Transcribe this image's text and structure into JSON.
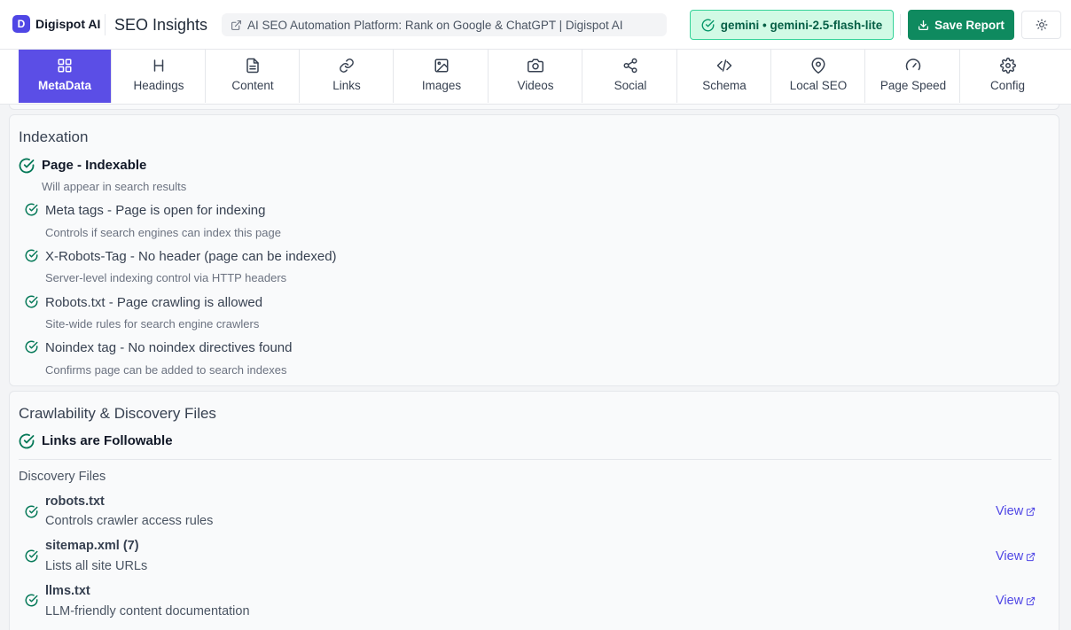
{
  "header": {
    "logo_letter": "D",
    "logo_text": "Digispot AI",
    "app_title": "SEO Insights",
    "page_url_title": "AI SEO Automation Platform: Rank on Google & ChatGPT | Digispot AI",
    "model_badge": "gemini • gemini-2.5-flash-lite",
    "save_label": "Save Report"
  },
  "tabs": [
    {
      "label": "MetaData",
      "icon": "grid-icon",
      "active": true
    },
    {
      "label": "Headings",
      "icon": "heading-icon"
    },
    {
      "label": "Content",
      "icon": "document-icon"
    },
    {
      "label": "Links",
      "icon": "link-icon"
    },
    {
      "label": "Images",
      "icon": "image-icon"
    },
    {
      "label": "Videos",
      "icon": "camera-icon"
    },
    {
      "label": "Social",
      "icon": "share-icon"
    },
    {
      "label": "Schema",
      "icon": "code-icon"
    },
    {
      "label": "Local SEO",
      "icon": "map-pin-icon"
    },
    {
      "label": "Page Speed",
      "icon": "gauge-icon"
    },
    {
      "label": "Config",
      "icon": "gear-icon"
    }
  ],
  "indexation": {
    "title": "Indexation",
    "main": {
      "label": "Page - Indexable",
      "desc": "Will appear in search results"
    },
    "items": [
      {
        "label": "Meta tags - Page is open for indexing",
        "desc": "Controls if search engines can index this page"
      },
      {
        "label": "X-Robots-Tag - No header (page can be indexed)",
        "desc": "Server-level indexing control via HTTP headers"
      },
      {
        "label": "Robots.txt - Page crawling is allowed",
        "desc": "Site-wide rules for search engine crawlers"
      },
      {
        "label": "Noindex tag - No noindex directives found",
        "desc": "Confirms page can be added to search indexes"
      }
    ]
  },
  "crawlability": {
    "title": "Crawlability & Discovery Files",
    "main": {
      "label": "Links are Followable"
    },
    "discovery_title": "Discovery Files",
    "files": [
      {
        "name": "robots.txt",
        "desc": "Controls crawler access rules",
        "action": "View"
      },
      {
        "name": "sitemap.xml (7)",
        "desc": "Lists all site URLs",
        "action": "View"
      },
      {
        "name": "llms.txt",
        "desc": "LLM-friendly content documentation",
        "action": "View"
      }
    ]
  },
  "colors": {
    "accent": "#5b4ee6",
    "success": "#0f8a5f",
    "link": "#4f46e5"
  }
}
